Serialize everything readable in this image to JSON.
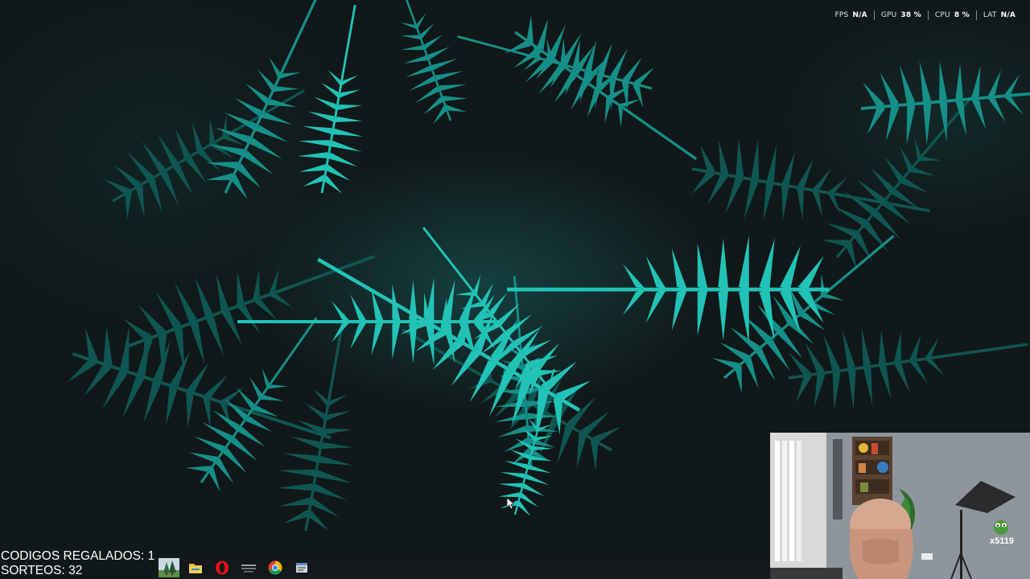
{
  "performance_overlay": {
    "items": [
      {
        "label": "FPS",
        "value": "N/A"
      },
      {
        "label": "GPU",
        "value": "38 %"
      },
      {
        "label": "CPU",
        "value": "8 %"
      },
      {
        "label": "LAT",
        "value": "N/A"
      }
    ]
  },
  "stream_stats": {
    "codes_line": "CODIGOS REGALADOS: 1",
    "raffles_line": "SORTEOS: 32"
  },
  "taskbar": {
    "apps": [
      {
        "name": "nature-app-icon"
      },
      {
        "name": "file-explorer-icon"
      },
      {
        "name": "opera-browser-icon"
      },
      {
        "name": "launcher-app-icon"
      },
      {
        "name": "chrome-browser-icon"
      },
      {
        "name": "window-app-icon"
      }
    ]
  },
  "webcam": {
    "badge": "x5119"
  },
  "colors": {
    "fern_bright": "#22c3b6",
    "fern_mid": "#168f88",
    "fern_dark": "#0f5652",
    "background": "#111819",
    "taskbar": "#14181a"
  }
}
